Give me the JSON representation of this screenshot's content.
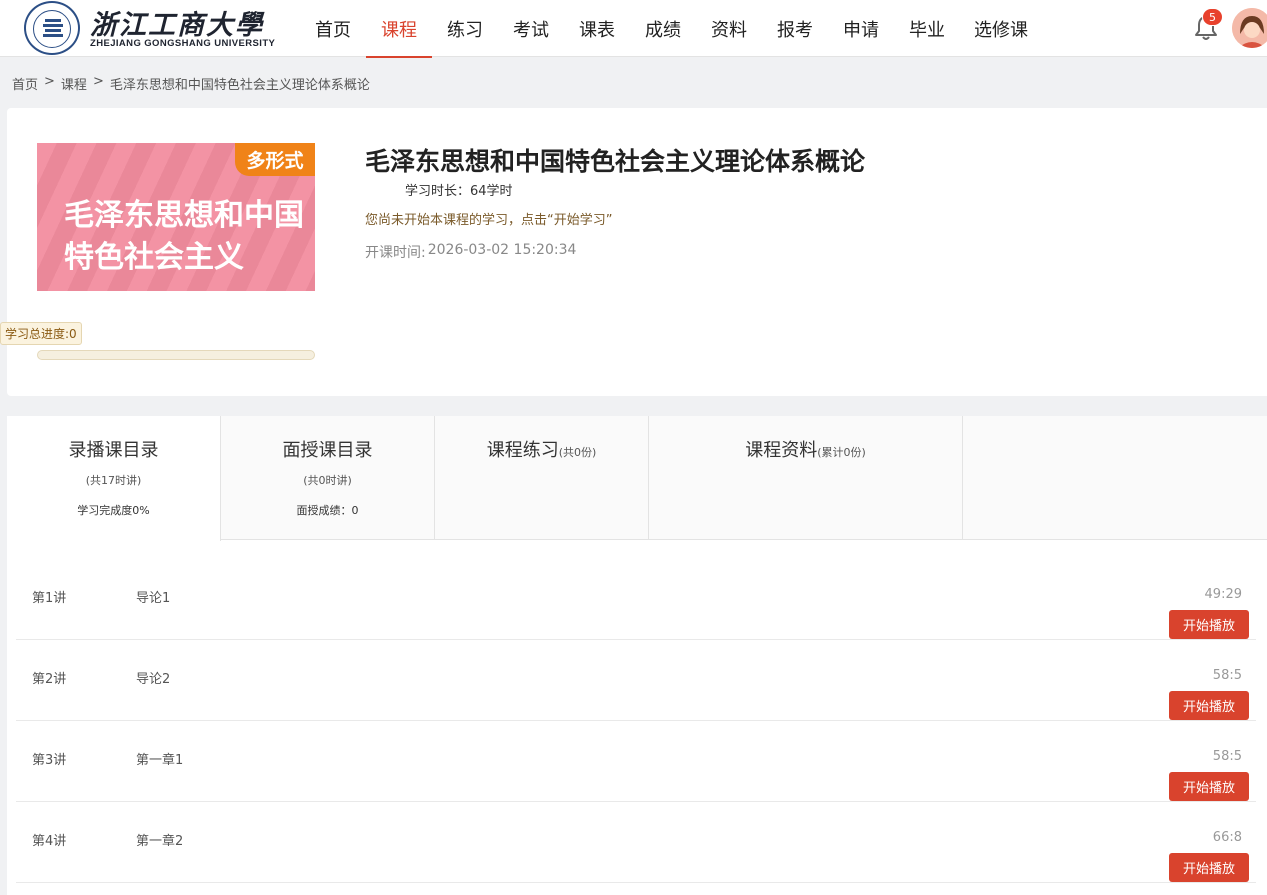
{
  "logo": {
    "cn": "浙江工商大學",
    "en": "ZHEJIANG GONGSHANG UNIVERSITY"
  },
  "nav": [
    {
      "label": "首页",
      "active": false
    },
    {
      "label": "课程",
      "active": true
    },
    {
      "label": "练习",
      "active": false
    },
    {
      "label": "考试",
      "active": false
    },
    {
      "label": "课表",
      "active": false
    },
    {
      "label": "成绩",
      "active": false
    },
    {
      "label": "资料",
      "active": false
    },
    {
      "label": "报考",
      "active": false
    },
    {
      "label": "申请",
      "active": false
    },
    {
      "label": "毕业",
      "active": false
    },
    {
      "label": "选修课",
      "active": false
    }
  ],
  "notifications": {
    "count": "5"
  },
  "breadcrumb": {
    "home": "首页",
    "sep": ">",
    "section": "课程",
    "current": "毛泽东思想和中国特色社会主义理论体系概论"
  },
  "course": {
    "cover_tag": "多形式",
    "cover_title": "毛泽东思想和中国特色社会主义",
    "progress_label": "学习总进度:0",
    "progress_value": 0,
    "title": "毛泽东思想和中国特色社会主义理论体系概论",
    "hours": "学习时长：64学时",
    "hint": "您尚未开始本课程的学习，点击“开始学习”",
    "start_label": "开课时间:",
    "start_time": "2026-03-02 15:20:34"
  },
  "tabs": [
    {
      "title": "录播课目录",
      "sub": "(共17时讲)",
      "extra": "学习完成度0%"
    },
    {
      "title": "面授课目录",
      "sub": "(共0时讲)",
      "extra": "面授成绩：0"
    },
    {
      "title": "课程练习",
      "small": "(共0份)"
    },
    {
      "title": "课程资料",
      "small": "(累计0份)"
    }
  ],
  "lessons": [
    {
      "no": "第1讲",
      "name": "导论1",
      "duration": "49:29",
      "button": "开始播放"
    },
    {
      "no": "第2讲",
      "name": "导论2",
      "duration": "58:5",
      "button": "开始播放"
    },
    {
      "no": "第3讲",
      "name": "第一章1",
      "duration": "58:5",
      "button": "开始播放"
    },
    {
      "no": "第4讲",
      "name": "第一章2",
      "duration": "66:8",
      "button": "开始播放"
    }
  ],
  "colors": {
    "accent": "#d9432d",
    "cover": "#f28c9e",
    "tag": "#f08318"
  }
}
